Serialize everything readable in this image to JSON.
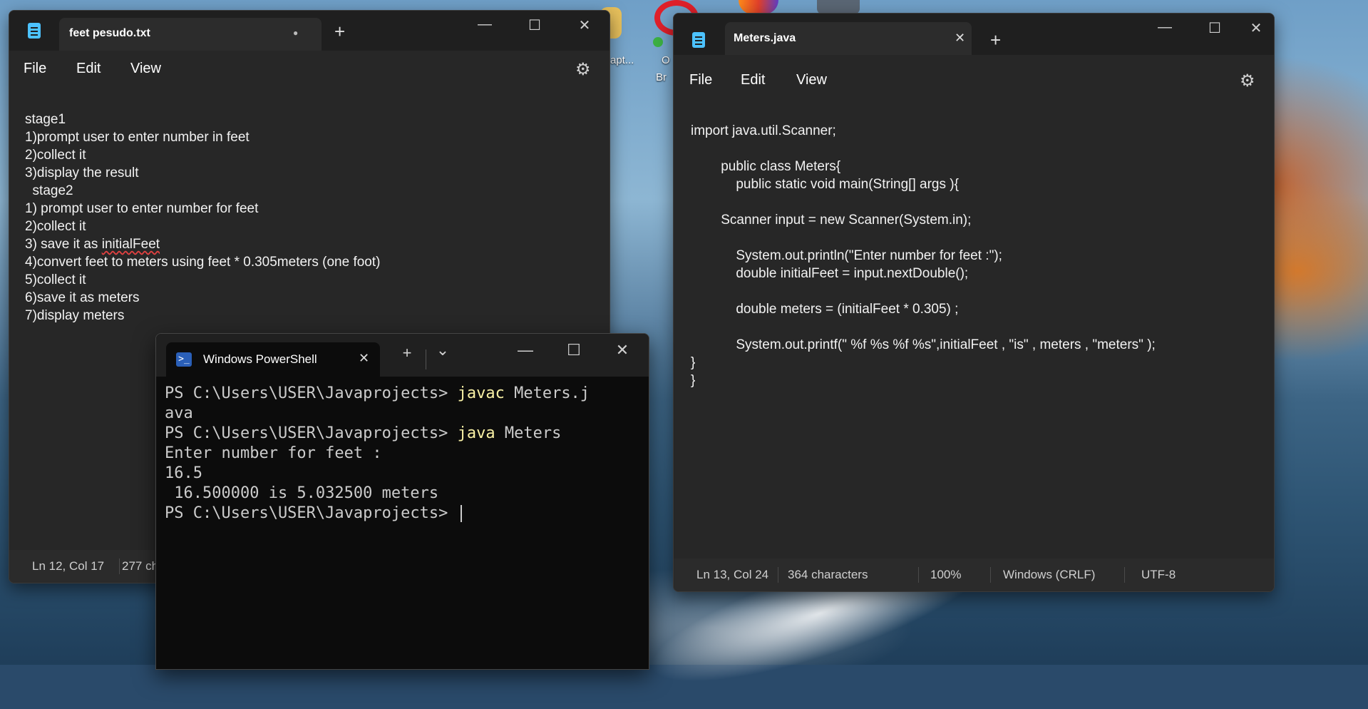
{
  "desktop": {
    "icon_labels": [
      "apt...",
      "O",
      "Br"
    ],
    "colors": {
      "sea": "#2f5675",
      "sky": "#8db6d3",
      "cliff": "#d67828"
    }
  },
  "left_notepad": {
    "tab_title": "feet pesudo.txt",
    "unsaved_dot": "●",
    "new_tab": "+",
    "controls": {
      "minimize": "—",
      "maximize": "☐",
      "close": "✕"
    },
    "menu": {
      "file": "File",
      "edit": "Edit",
      "view": "View"
    },
    "lines": [
      "stage1",
      "1)prompt user to enter number in feet",
      "2)collect it",
      "3)display the result",
      "  stage2",
      "1) prompt user to enter number for feet",
      "2)collect it",
      "3) save it as ",
      "4)convert feet to meters using feet * 0.305meters (one foot)",
      "5)collect it",
      "6)save it as meters",
      "7)display meters"
    ],
    "misspelled_word": "initialFeet",
    "status": {
      "position": "Ln 12, Col 17",
      "characters": "277 ch"
    }
  },
  "right_notepad": {
    "tab_title": "Meters.java",
    "close_tab": "✕",
    "new_tab": "+",
    "controls": {
      "minimize": "—",
      "maximize": "☐",
      "close": "✕"
    },
    "menu": {
      "file": "File",
      "edit": "Edit",
      "view": "View"
    },
    "lines": [
      "import java.util.Scanner;",
      "",
      "\t\tpublic class Meters{",
      "\t\t\tpublic static void main(String[] args ){",
      "",
      "\t\tScanner input = new Scanner(System.in);",
      "",
      "\t\t\tSystem.out.println(\"Enter number for feet :\");",
      "\t\t\tdouble initialFeet = input.nextDouble();",
      "",
      "\t\t\tdouble meters = (initialFeet * 0.305) ;",
      "",
      "\t\t\tSystem.out.printf(\" %f %s %f %s\",initialFeet , \"is\" , meters , \"meters\" );",
      "}",
      "}"
    ],
    "status": {
      "position": "Ln 13, Col 24",
      "characters": "364 characters",
      "zoom": "100%",
      "line_ending": "Windows (CRLF)",
      "encoding": "UTF-8"
    }
  },
  "powershell": {
    "tab_title": "Windows PowerShell",
    "icon_glyph": ">_",
    "close_tab": "✕",
    "new_tab": "+",
    "dropdown": "⌄",
    "controls": {
      "minimize": "—",
      "maximize": "☐",
      "close": "✕"
    },
    "prompt": "PS C:\\Users\\USER\\Javaprojects> ",
    "cmd1_keyword": "javac",
    "cmd1_arg": " Meters.j",
    "cmd1_wrap": "ava",
    "cmd2_keyword": "java",
    "cmd2_arg": " Meters",
    "out1": "Enter number for feet :",
    "out2": "16.5",
    "out3": " 16.500000 is 5.032500 meters"
  }
}
